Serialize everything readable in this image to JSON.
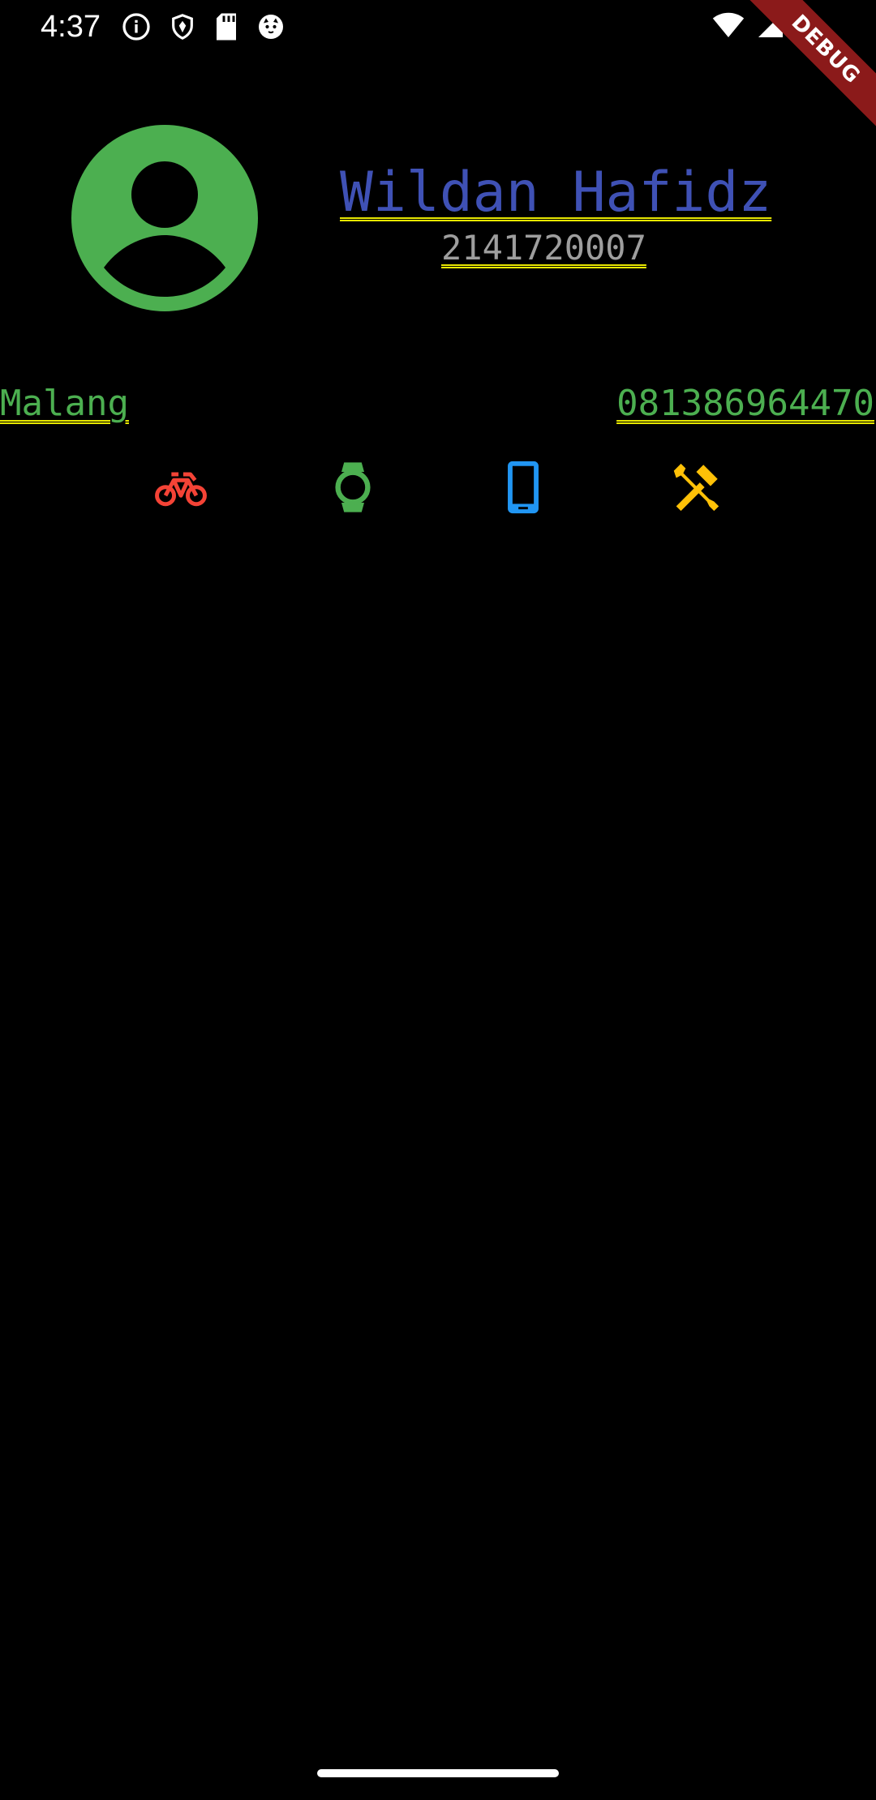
{
  "status_bar": {
    "time": "4:37",
    "left_icons": [
      "info-icon",
      "shield-icon",
      "sd-card-icon",
      "cat-face-icon"
    ],
    "right_icons": [
      "wifi-icon",
      "signal-icon",
      "battery-icon"
    ]
  },
  "debug_banner": {
    "label": "DEBUG",
    "color": "#8b1a1a"
  },
  "profile": {
    "avatar_icon": "account-circle-icon",
    "avatar_color": "#4caf50",
    "name": "Wildan Hafidz",
    "name_color": "#3f51b5",
    "nim": "2141720007",
    "nim_color": "#9e9e9e"
  },
  "contact": {
    "city": "Malang",
    "phone": "081386964470",
    "color": "#4caf50"
  },
  "hobbies": [
    {
      "icon": "bike-icon",
      "color": "#f44336"
    },
    {
      "icon": "watch-icon",
      "color": "#4caf50"
    },
    {
      "icon": "smartphone-icon",
      "color": "#2196f3"
    },
    {
      "icon": "tools-icon",
      "color": "#ffc107"
    }
  ]
}
